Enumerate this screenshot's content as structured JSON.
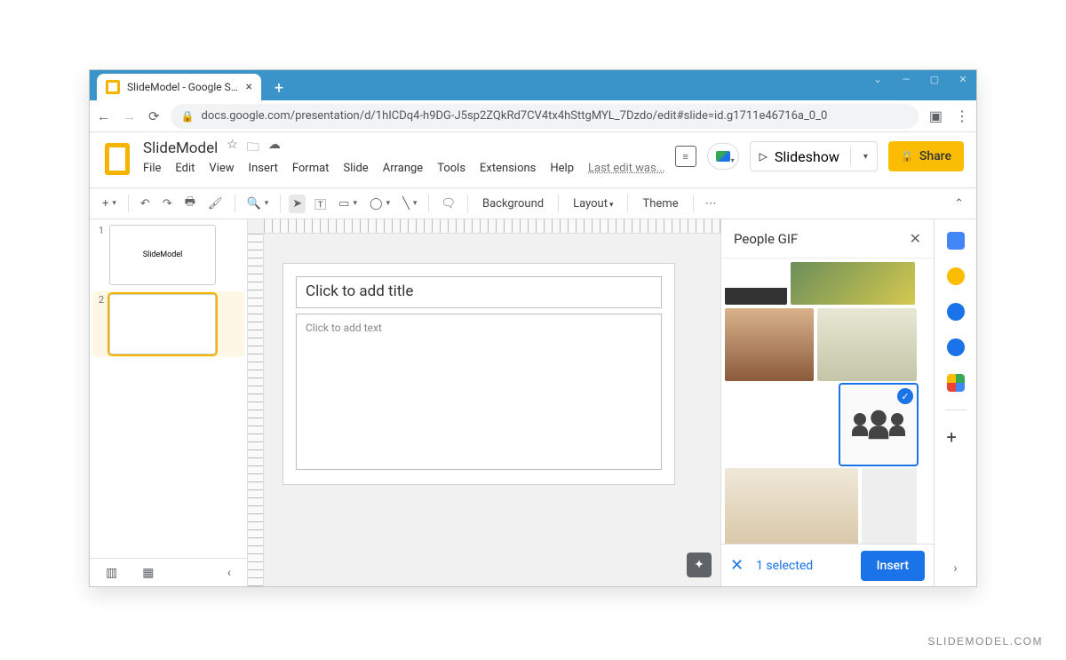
{
  "browser": {
    "tab_title": "SlideModel - Google Slides",
    "url": "docs.google.com/presentation/d/1hICDq4-h9DG-J5sp2ZQkRd7CV4tx4hSttgMYL_7Dzdo/edit#slide=id.g1711e46716a_0_0"
  },
  "app": {
    "doc_title": "SlideModel",
    "menus": [
      "File",
      "Edit",
      "View",
      "Insert",
      "Format",
      "Slide",
      "Arrange",
      "Tools",
      "Extensions",
      "Help"
    ],
    "last_edit": "Last edit was...",
    "slideshow_label": "Slideshow",
    "share_label": "Share"
  },
  "toolbar": {
    "background": "Background",
    "layout": "Layout",
    "theme": "Theme"
  },
  "thumbnails": [
    {
      "num": "1",
      "label": "SlideModel",
      "selected": false
    },
    {
      "num": "2",
      "label": "",
      "selected": true
    }
  ],
  "canvas": {
    "title_placeholder": "Click to add title",
    "body_placeholder": "Click to add text"
  },
  "side_panel": {
    "title": "People GIF",
    "selected_count": "1 selected",
    "insert_label": "Insert"
  },
  "watermark": "SLIDEMODEL.COM"
}
